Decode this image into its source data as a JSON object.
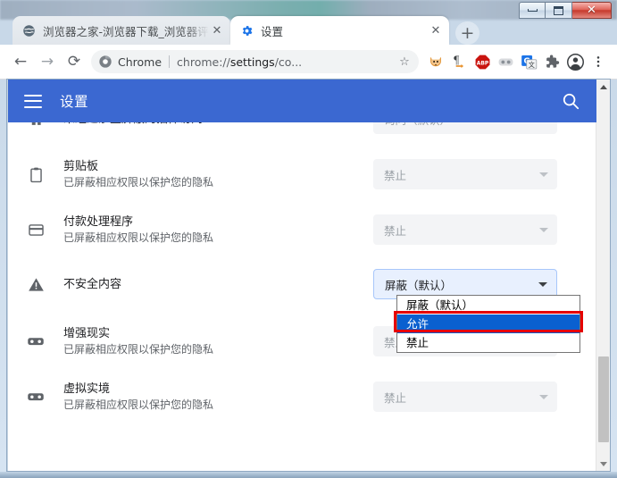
{
  "window": {
    "controls": {
      "minimize": "minimize",
      "maximize": "maximize",
      "close": "✕"
    }
  },
  "tabs": [
    {
      "title": "浏览器之家-浏览器下载_浏览器评",
      "favicon": "globe-icon",
      "active": false,
      "close_label": "✕"
    },
    {
      "title": "设置",
      "favicon": "gear-icon",
      "active": true,
      "close_label": "✕"
    }
  ],
  "new_tab_label": "+",
  "toolbar": {
    "back_label": "←",
    "forward_label": "→",
    "reload_label": "⟳",
    "omnibox": {
      "chip": "Chrome",
      "url_prefix": "chrome://",
      "url_highlight": "settings",
      "url_suffix": "/co...",
      "star_label": "☆"
    },
    "extensions": [
      {
        "name": "fox-extension-icon"
      },
      {
        "name": "pilcrow-extension-icon",
        "label": "¶"
      },
      {
        "name": "adblock-plus-icon",
        "label": "ABP"
      },
      {
        "name": "grey-panel-extension-icon"
      },
      {
        "name": "google-translate-icon",
        "label": "G"
      },
      {
        "name": "extensions-puzzle-icon"
      },
      {
        "name": "profile-avatar-icon"
      },
      {
        "name": "chrome-menu-icon",
        "label": "⋮"
      }
    ]
  },
  "settings": {
    "app_title": "设置",
    "menu_label": "menu",
    "search_label": "search",
    "rows": [
      {
        "icon": "home-icon",
        "title": "未经过沙盒屏蔽的插件访问",
        "subtitle": "",
        "select_value": "询问（默认）",
        "state": "clipped"
      },
      {
        "icon": "clipboard-icon",
        "title": "剪贴板",
        "subtitle": "已屏蔽相应权限以保护您的隐私",
        "select_value": "禁止",
        "state": "normal"
      },
      {
        "icon": "payment-card-icon",
        "title": "付款处理程序",
        "subtitle": "已屏蔽相应权限以保护您的隐私",
        "select_value": "禁止",
        "state": "normal"
      },
      {
        "icon": "warning-triangle-icon",
        "title": "不安全内容",
        "subtitle": "",
        "select_value": "屏蔽（默认）",
        "state": "open"
      },
      {
        "icon": "vr-goggles-icon",
        "title": "增强现实",
        "subtitle": "已屏蔽相应权限以保护您的隐私",
        "select_value": "禁止",
        "state": "normal"
      },
      {
        "icon": "vr-goggles-icon",
        "title": "虚拟实境",
        "subtitle": "已屏蔽相应权限以保护您的隐私",
        "select_value": "禁止",
        "state": "normal"
      }
    ],
    "dropdown": {
      "options": [
        "屏蔽（默认）",
        "允许",
        "禁止"
      ],
      "selected_index": 1,
      "annotation_color": "#e60000",
      "highlight_color": "#0a60d0"
    }
  },
  "colors": {
    "appbar_blue": "#3b68d1",
    "select_bg": "#f3f4f6",
    "active_select_bg": "#e8f0fe"
  }
}
